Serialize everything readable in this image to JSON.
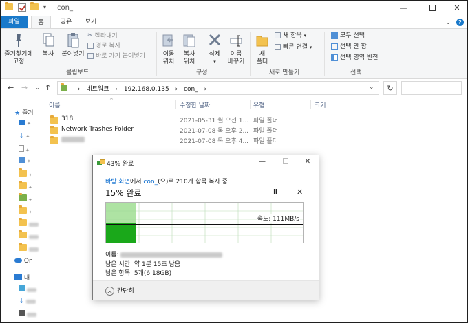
{
  "window": {
    "title": "con_",
    "minimize": "—",
    "close": "✕"
  },
  "ribbon_tabs": {
    "file": "파일",
    "home": "홈",
    "share": "공유",
    "view": "보기"
  },
  "ribbon": {
    "clipboard": {
      "pin_label": "즐겨찾기에\n고정",
      "copy_label": "복사",
      "paste_label": "붙여넣기",
      "cut_label": "잘라내기",
      "copy_path_label": "경로 복사",
      "paste_shortcut_label": "바로 가기 붙여넣기",
      "group_label": "클립보드"
    },
    "organize": {
      "move_to_label": "이동\n위치",
      "copy_to_label": "복사\n위치",
      "delete_label": "삭제",
      "rename_label": "이름\n바꾸기",
      "group_label": "구성"
    },
    "new": {
      "new_folder_label": "새\n폴더",
      "new_item_label": "새 항목",
      "easy_access_label": "빠른 연결",
      "group_label": "새로 만들기"
    },
    "select": {
      "select_all_label": "모두 선택",
      "select_none_label": "선택 안 함",
      "invert_label": "선택 영역 반전",
      "group_label": "선택"
    }
  },
  "address": {
    "crumbs": [
      "네트워크",
      "192.168.0.135",
      "con_"
    ]
  },
  "columns": {
    "name": "이름",
    "modified": "수정한 날짜",
    "type": "유형",
    "size": "크기"
  },
  "files": [
    {
      "name": "318",
      "date": "2021-05-31 월 오전 1...",
      "type": "파일 폴더"
    },
    {
      "name": "Network Trashes Folder",
      "date": "2021-07-08 목 오후 2...",
      "type": "파일 폴더"
    },
    {
      "name": "",
      "date": "2021-07-08 목 오후 4...",
      "type": "파일 폴더"
    }
  ],
  "navpane": {
    "quick_access": "즐겨",
    "onedrive": "On",
    "this_pc": "내",
    "network": "네트"
  },
  "copy_dialog": {
    "title": "43% 완료",
    "source_prefix": "바탕 화면",
    "source_mid": "에서 ",
    "dest": "con_",
    "source_suffix": "(으)로 210개 항목 복사 중",
    "percent_text": "15% 완료",
    "pause": "II",
    "cancel": "✕",
    "speed": "속도: 111MB/s",
    "name_label": "이름:",
    "time_left": "남은 시간: 약 1분 15초 남음",
    "items_left": "남은 항목: 5개(6.18GB)",
    "less_details": "간단히",
    "progress_fraction": 0.15,
    "colors": {
      "light_fill": "#aee3a3",
      "dark_fill": "#1aa81a",
      "link": "#0066cc"
    }
  }
}
